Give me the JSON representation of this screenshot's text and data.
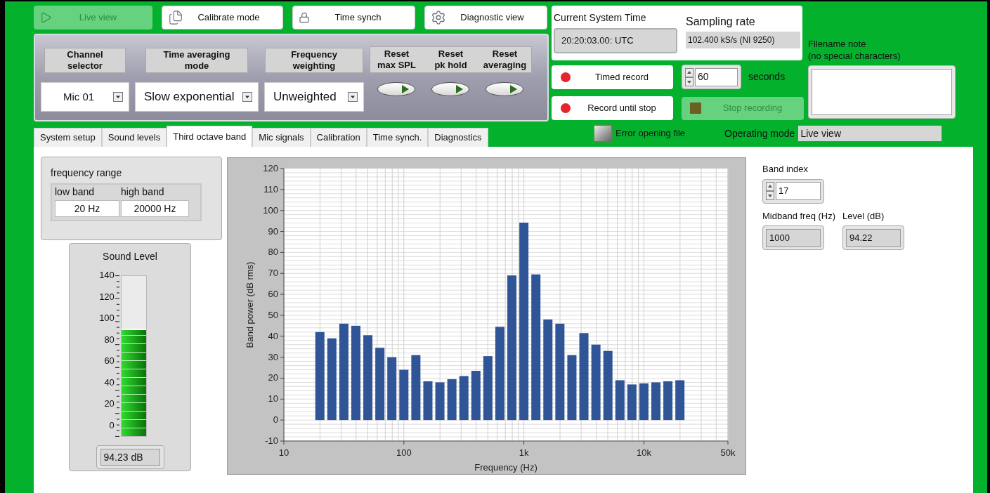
{
  "mode_buttons": [
    {
      "label": "Live view",
      "selected": true
    },
    {
      "label": "Calibrate mode",
      "selected": false
    },
    {
      "label": "Time synch",
      "selected": false
    },
    {
      "label": "Diagnostic view",
      "selected": false
    }
  ],
  "control_panel": {
    "selectors": [
      {
        "label": "Channel\nselector",
        "value": "Mic 01"
      },
      {
        "label": "Time averaging\nmode",
        "value": "Slow exponential"
      },
      {
        "label": "Frequency\nweighting",
        "value": "Unweighted"
      }
    ],
    "reset_buttons": [
      {
        "label": "Reset\nmax SPL"
      },
      {
        "label": "Reset\npk hold"
      },
      {
        "label": "Reset\naveraging"
      }
    ]
  },
  "system_time": {
    "label": "Current System Time",
    "value": "20:20:03.00: UTC"
  },
  "sampling_rate": {
    "label": "Sampling rate",
    "value": "102.400 kS/s (NI 9250)"
  },
  "record_buttons": [
    {
      "label": "Timed record"
    },
    {
      "label": "Record until stop"
    }
  ],
  "duration": {
    "value": "60",
    "unit": "seconds"
  },
  "stop_button": {
    "label": "Stop recording",
    "disabled": true
  },
  "filename_note": {
    "label": "Filename note\n(no special characters)"
  },
  "error_indicator": {
    "label": "Error opening file",
    "on": false
  },
  "operating_mode": {
    "label": "Operating mode",
    "value": "Live view"
  },
  "tabs": [
    {
      "label": "System setup",
      "selected": false
    },
    {
      "label": "Sound levels",
      "selected": false
    },
    {
      "label": "Third octave band",
      "selected": true
    },
    {
      "label": "Mic signals",
      "selected": false
    },
    {
      "label": "Calibration",
      "selected": false
    },
    {
      "label": "Time synch.",
      "selected": false
    },
    {
      "label": "Diagnostics",
      "selected": false
    }
  ],
  "frequency_range": {
    "title": "frequency range",
    "fields": [
      {
        "label": "low band",
        "value": "20 Hz"
      },
      {
        "label": "high band",
        "value": "20000 Hz"
      }
    ]
  },
  "sound_level": {
    "title": "Sound Level",
    "scale": [
      "140",
      "120",
      "100",
      "80",
      "60",
      "40",
      "20",
      "0"
    ],
    "level": 0.673,
    "reading": "94.23 dB"
  },
  "spectrum": {
    "chart_data": {
      "type": "bar",
      "xlabel": "Frequency (Hz)",
      "ylabel": "Band power (dB rms)",
      "categories": [
        "10",
        null,
        null,
        null,
        null,
        null,
        null,
        null,
        null,
        null,
        "100",
        null,
        null,
        null,
        null,
        null,
        null,
        null,
        null,
        null,
        "1k",
        null,
        null,
        null,
        null,
        null,
        null,
        null,
        null,
        null,
        "10k",
        null,
        null,
        null,
        null,
        null,
        null,
        "50k"
      ],
      "values": [
        null,
        null,
        null,
        42,
        39,
        46,
        45,
        40.5,
        34.5,
        30,
        24,
        31,
        18.5,
        18,
        19.5,
        21,
        23.5,
        30.5,
        44.5,
        69,
        94.2,
        69.5,
        48,
        46,
        31,
        41.5,
        36,
        33,
        19,
        17,
        17.5,
        18,
        18.5,
        19,
        null,
        null,
        null,
        null
      ],
      "ylim": [
        -10,
        120
      ],
      "grid": true,
      "yticks": [
        -10,
        0,
        10,
        20,
        30,
        40,
        50,
        60,
        70,
        80,
        90,
        100,
        110,
        120
      ]
    }
  },
  "band_index": {
    "label": "Band index",
    "value": "17"
  },
  "readouts": [
    {
      "label": "Midband freq (Hz)",
      "value": "1000"
    },
    {
      "label": "Level (dB)",
      "value": "94.22"
    }
  ]
}
